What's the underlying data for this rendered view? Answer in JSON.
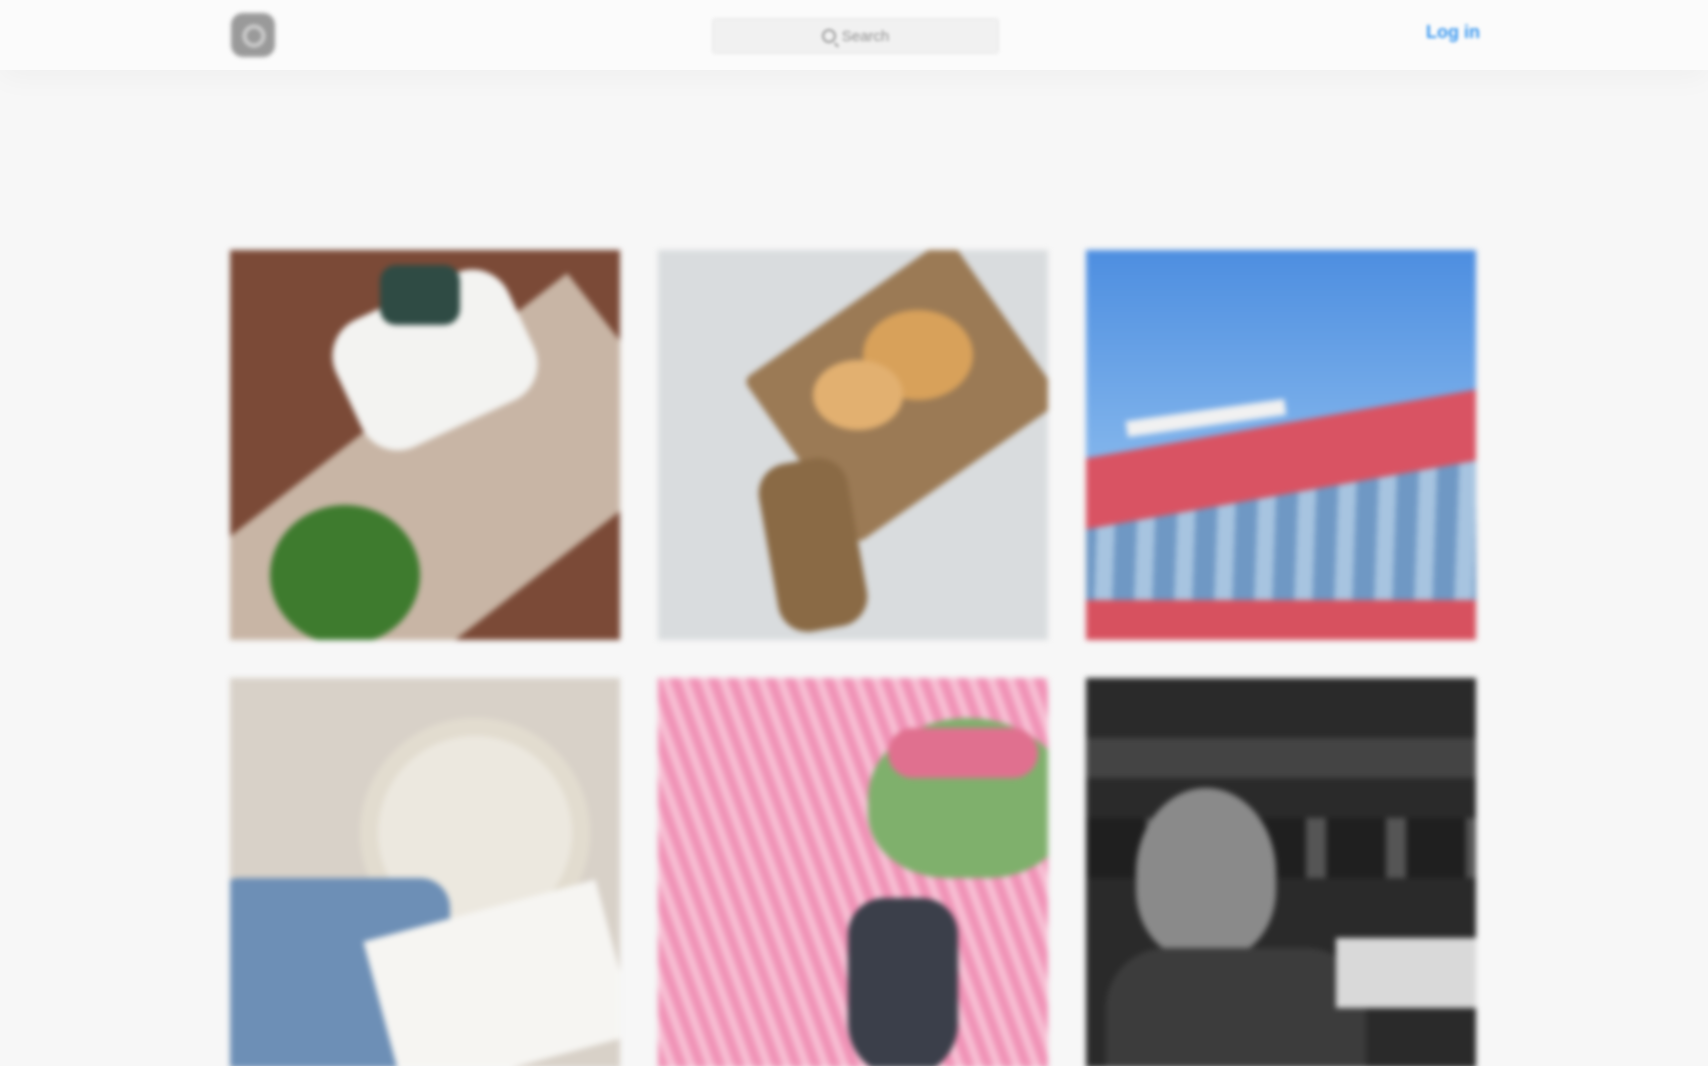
{
  "header": {
    "logo_icon": "camera-logo-icon",
    "search": {
      "icon": "search-icon",
      "placeholder": "Search"
    },
    "login_label": "Log in",
    "login_color": "#3897f0"
  },
  "grid": {
    "tiles": [
      {
        "name": "photo-legs-plant"
      },
      {
        "name": "photo-croissants-board"
      },
      {
        "name": "photo-building-sky"
      },
      {
        "name": "photo-rattan-bag"
      },
      {
        "name": "photo-pink-dress-tulips"
      },
      {
        "name": "photo-bw-cinema"
      }
    ]
  }
}
